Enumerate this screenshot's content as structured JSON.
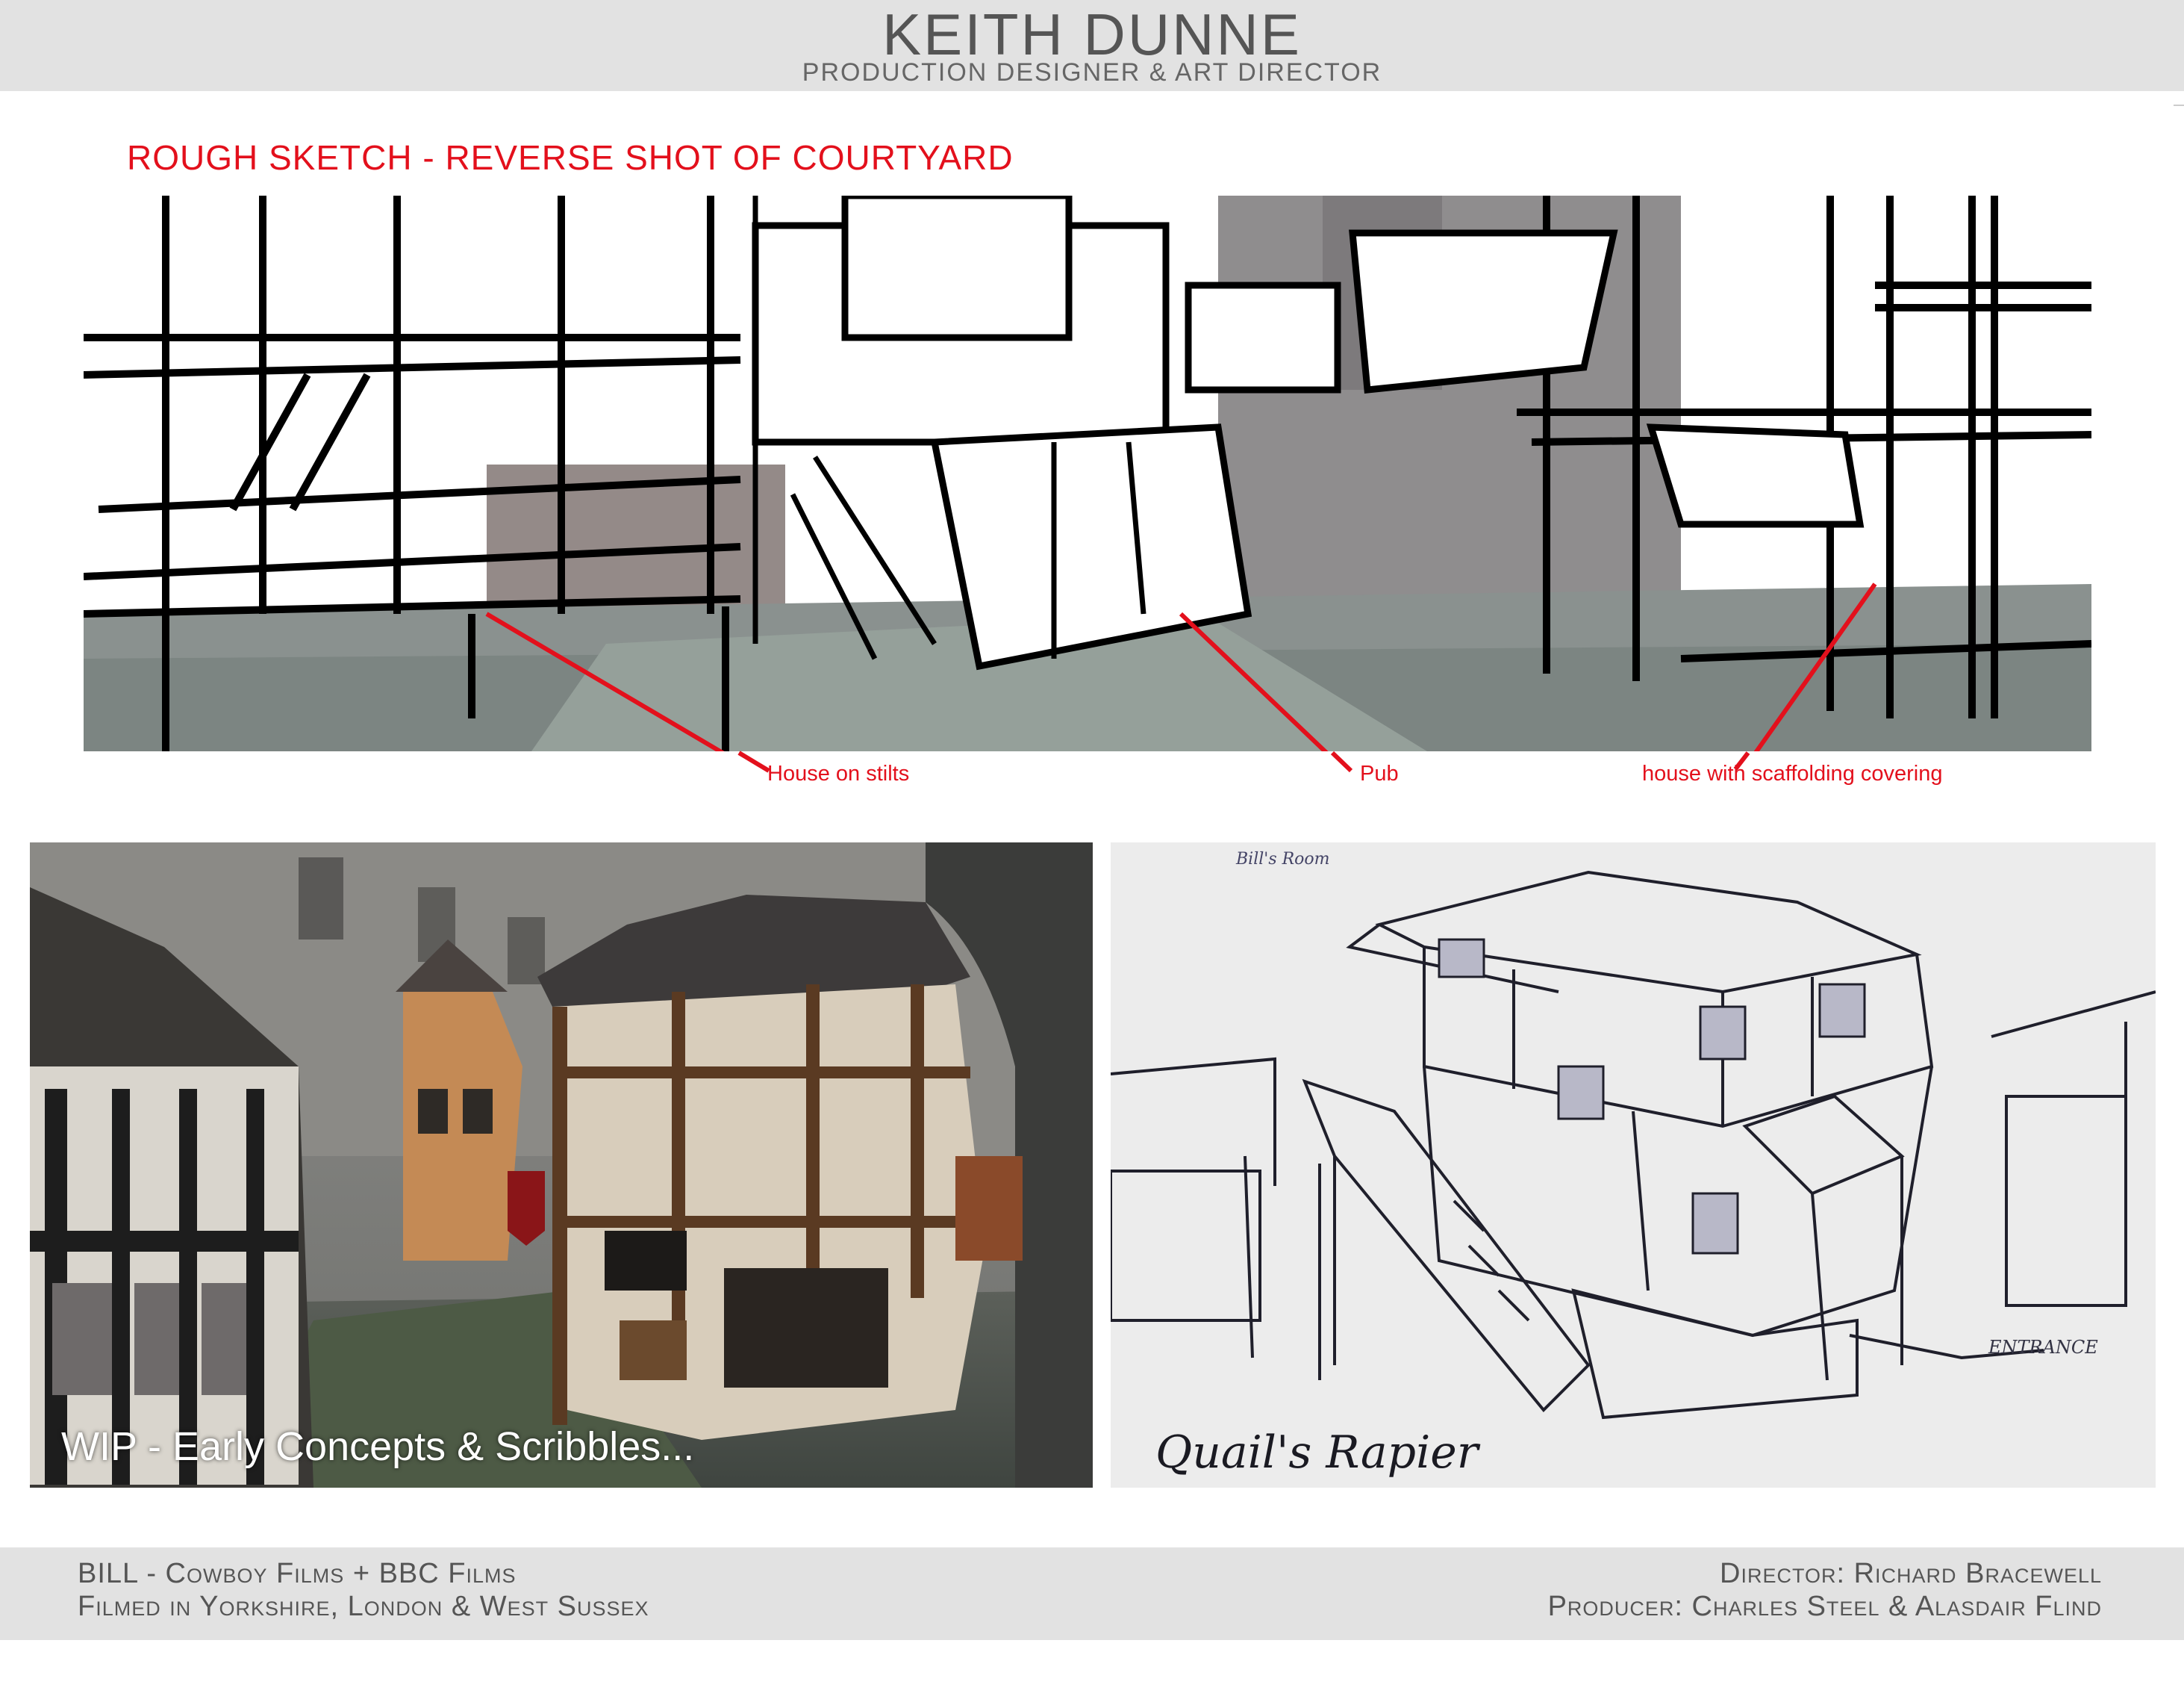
{
  "header": {
    "name": "KEITH DUNNE",
    "role": "PRODUCTION DESIGNER & ART DIRECTOR"
  },
  "sketch": {
    "title": "ROUGH SKETCH - REVERSE SHOT OF COURTYARD",
    "annotations": [
      {
        "label": "House on stilts"
      },
      {
        "label": "Pub"
      },
      {
        "label": "house with scaffolding covering"
      }
    ],
    "annotation_color": "#e3101c"
  },
  "concept_painting": {
    "caption": "WIP - Early Concepts & Scribbles..."
  },
  "pen_sketch": {
    "handwritten_title": "Quail's Rapier",
    "note_top": "Bill's Room",
    "note_entrance": "ENTRANCE"
  },
  "footer": {
    "left_line1": "BILL - Cowboy Films + BBC Films",
    "left_line2": "Filmed in Yorkshire, London & West Sussex",
    "right_line1": "Director: Richard Bracewell",
    "right_line2": "Producer: Charles Steel & Alasdair Flind"
  }
}
